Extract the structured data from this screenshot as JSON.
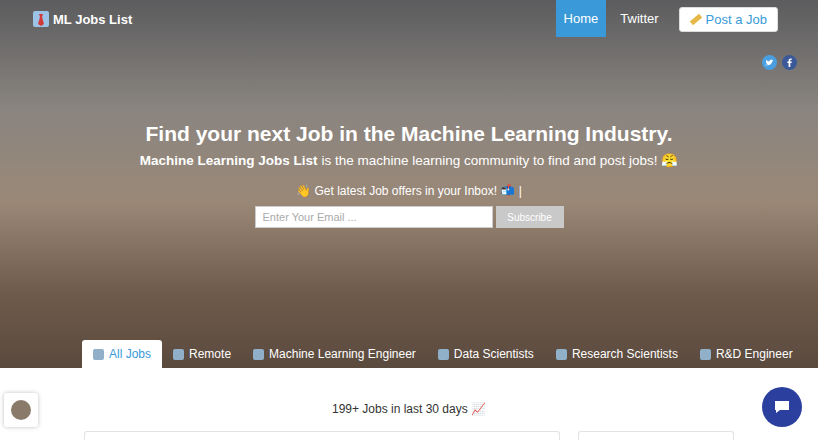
{
  "nav": {
    "logo": "ML Jobs List",
    "links": [
      {
        "label": "Home",
        "selected": true
      },
      {
        "label": "Twitter",
        "selected": false
      }
    ],
    "post_button": "Post a Job"
  },
  "hero": {
    "title": "Find your next Job in the Machine Learning Industry.",
    "subtitle_brand": "Machine Learning Jobs List",
    "subtitle_rest": "is the machine learning community to find and post jobs! 😤"
  },
  "subscribe": {
    "prompt": "👋 Get latest Job offers in your Inbox! 📬 |",
    "placeholder": "Enter Your Email ...",
    "button": "Subscribe"
  },
  "tabs": [
    {
      "label": "All Jobs",
      "selected": true
    },
    {
      "label": "Remote",
      "selected": false
    },
    {
      "label": "Machine Learning Engineer",
      "selected": false
    },
    {
      "label": "Data Scientists",
      "selected": false
    },
    {
      "label": "Research Scientists",
      "selected": false
    },
    {
      "label": "R&D Engineer",
      "selected": false
    }
  ],
  "jobs_count": "199+ Jobs in last 30 days 📈"
}
